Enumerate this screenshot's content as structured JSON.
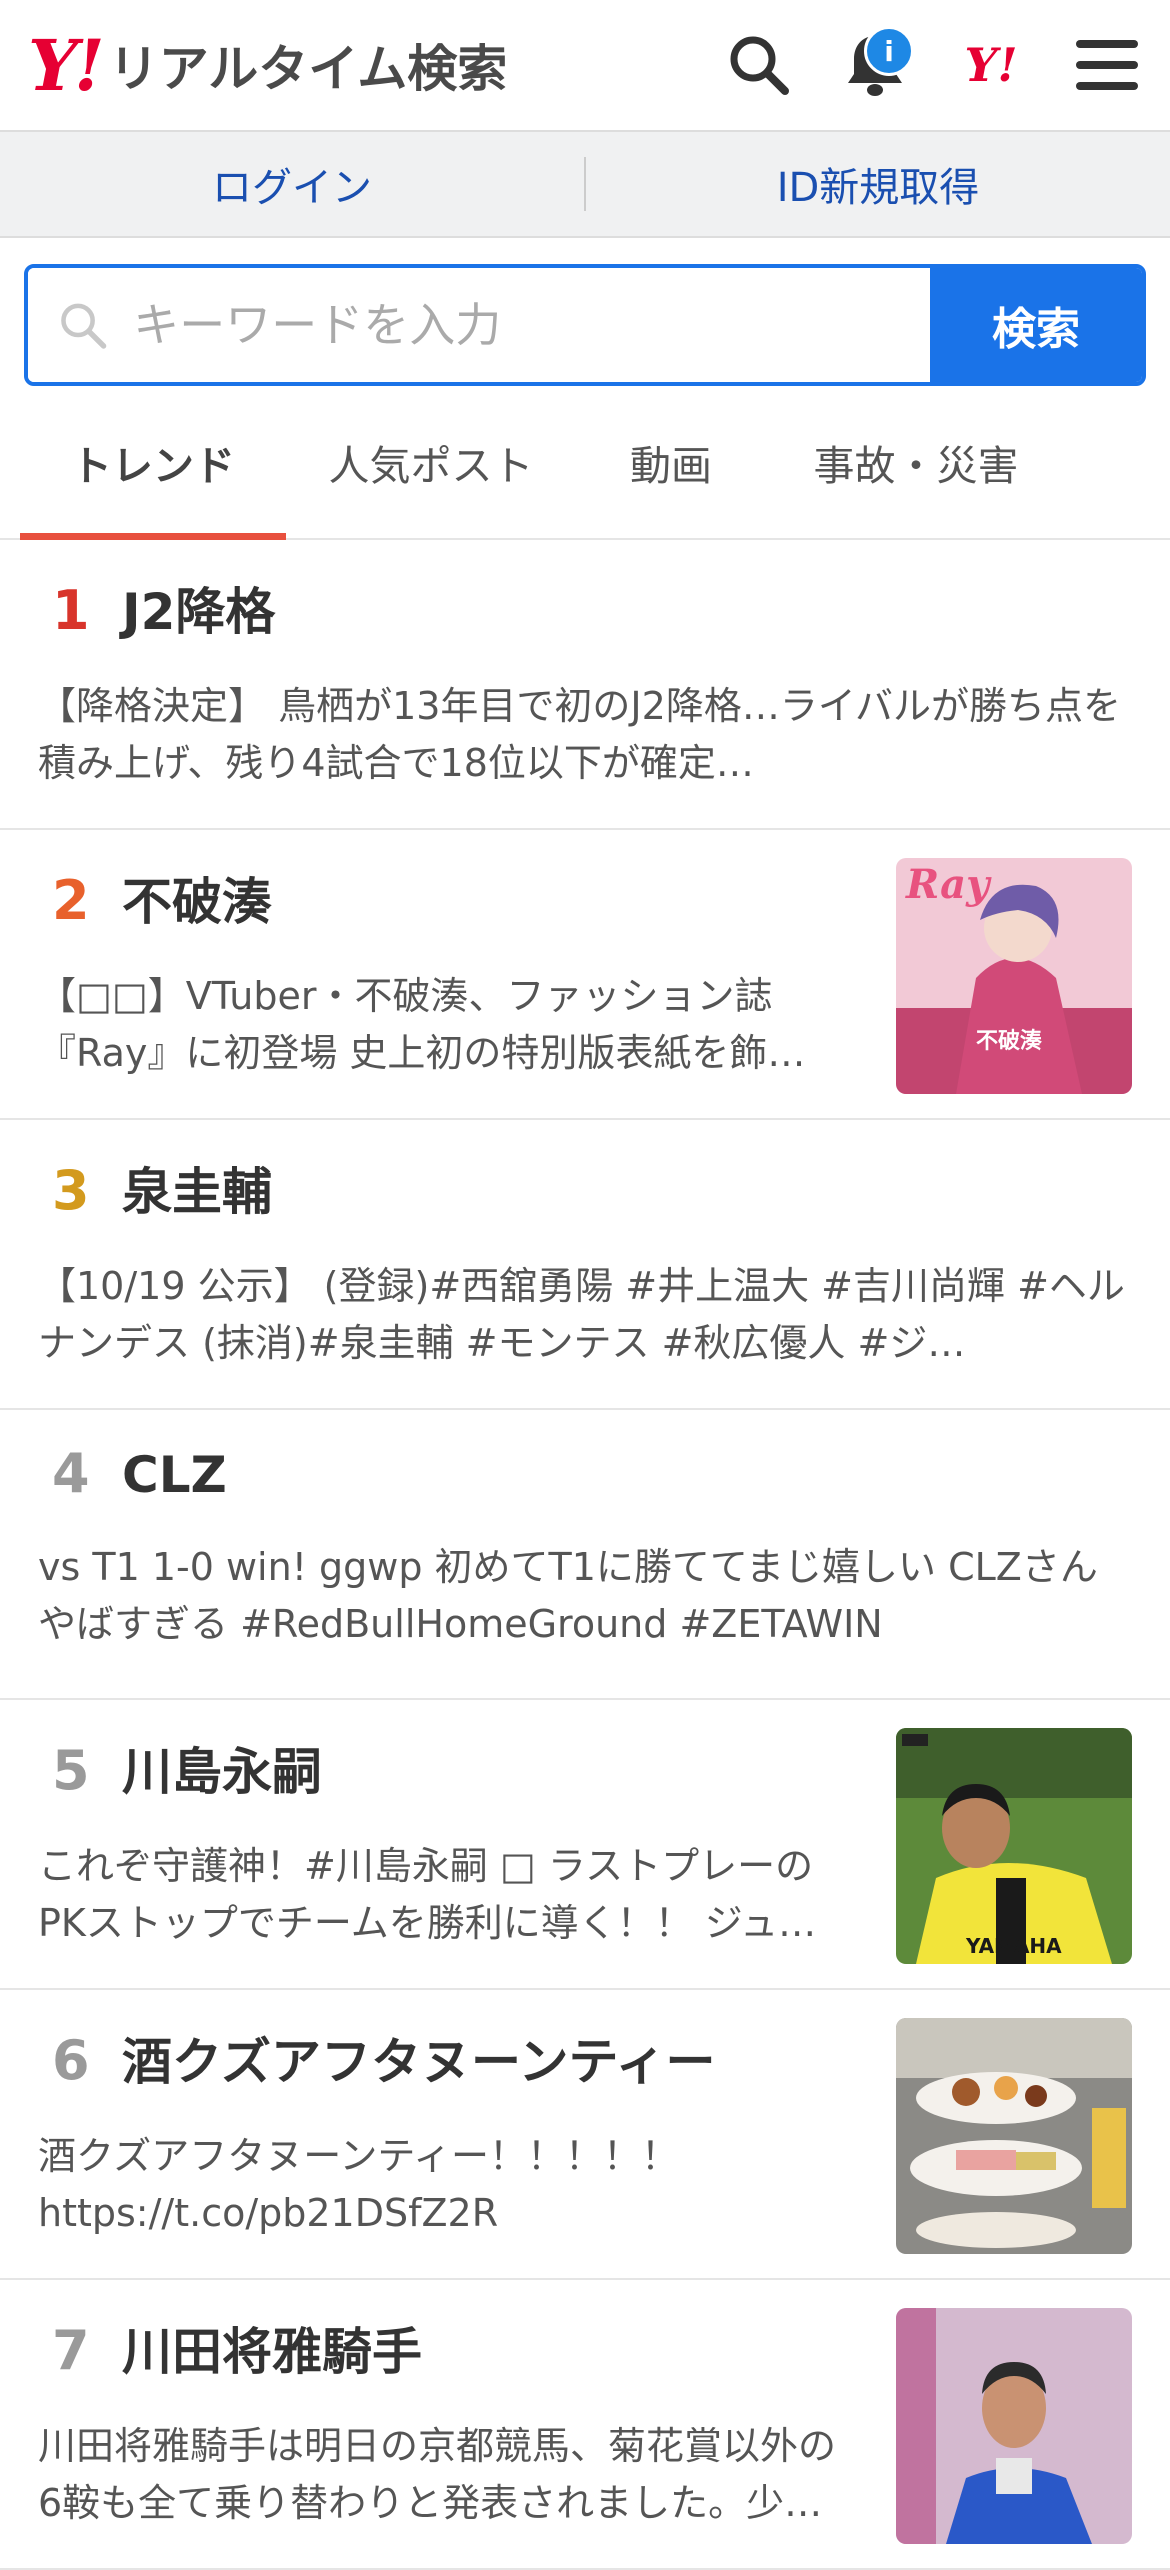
{
  "header": {
    "logo_mark": "Y!",
    "logo_text": "リアルタイム検索",
    "notification_badge": "i",
    "yahoo_small": "Y!"
  },
  "login_bar": {
    "login": "ログイン",
    "signup": "ID新規取得"
  },
  "search": {
    "placeholder": "キーワードを入力",
    "button": "検索"
  },
  "tabs": [
    "トレンド",
    "人気ポスト",
    "動画",
    "事故・災害"
  ],
  "colors": {
    "accent_blue": "#1a73e8",
    "tab_underline": "#e8503e",
    "brand_red": "#e60033"
  },
  "trends": [
    {
      "rank": "1",
      "title": "J2降格",
      "rank_color": "#d8342b",
      "desc": "【降格決定】 鳥栖が13年目で初のJ2降格…ライバルが勝ち点を積み上げ、残り4試合で18位以下が確定…"
    },
    {
      "rank": "2",
      "title": "不破湊",
      "rank_color": "#e8612c",
      "desc": "【□□】VTuber・不破湊、ファッション誌『Ray』に初登場 史上初の特別版表紙を飾…"
    },
    {
      "rank": "3",
      "title": "泉圭輔",
      "rank_color": "#d39a1e",
      "desc": "【10/19 公示】 (登録)#西舘勇陽 #井上温大 #吉川尚輝 #ヘルナンデス (抹消)#泉圭輔 #モンテス #秋広優人 #ジ…"
    },
    {
      "rank": "4",
      "title": "CLZ",
      "rank_color": "#9a9a9a",
      "desc": "vs T1 1-0 win! ggwp 初めてT1に勝ててまじ嬉しい CLZさんやばすぎる #RedBullHomeGround #ZETAWIN"
    },
    {
      "rank": "5",
      "title": "川島永嗣",
      "rank_color": "#9a9a9a",
      "desc": "これぞ守護神！#川島永嗣 □ ラストプレーのPKストップでチームを勝利に導く！！ ジュ…"
    },
    {
      "rank": "6",
      "title": "酒クズアフタヌーンティー",
      "rank_color": "#9a9a9a",
      "desc": "酒クズアフタヌーンティー！！！！！ https://t.co/pb21DSfZ2R"
    },
    {
      "rank": "7",
      "title": "川田将雅騎手",
      "rank_color": "#9a9a9a",
      "desc": "川田将雅騎手は明日の京都競馬、菊花賞以外の6鞍も全て乗り替わりと発表されました。少…"
    }
  ],
  "thumb_labels": {
    "ray_title": "Ray",
    "ray_name": "不破湊",
    "kit_text": "YAMAHA"
  }
}
